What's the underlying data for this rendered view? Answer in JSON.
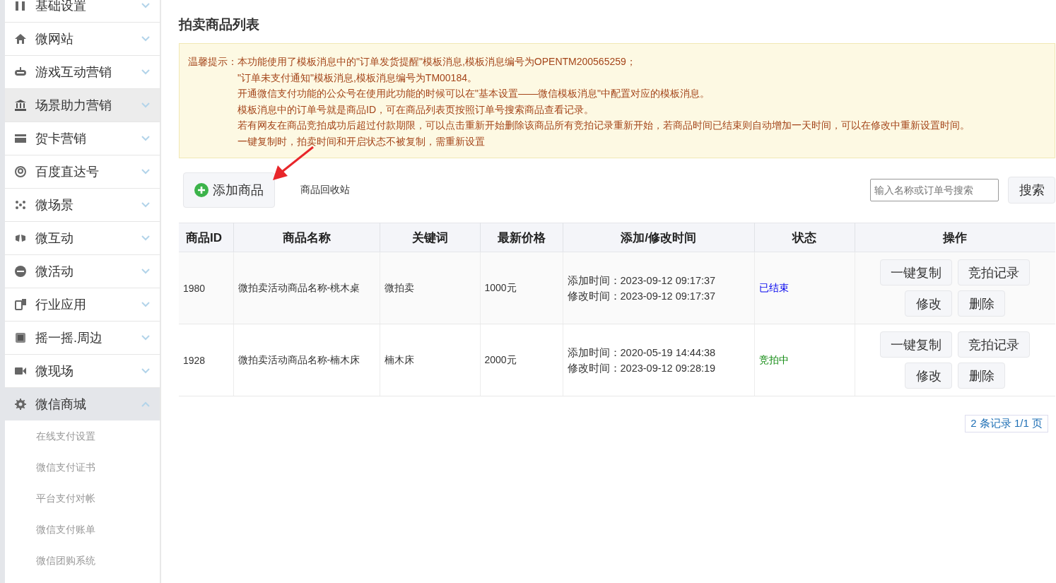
{
  "sidebar": {
    "items": [
      {
        "label": "基础设置",
        "selected": false,
        "expanded": false
      },
      {
        "label": "微网站",
        "selected": false,
        "expanded": false
      },
      {
        "label": "游戏互动营销",
        "selected": false,
        "expanded": false
      },
      {
        "label": "场景助力营销",
        "selected": true,
        "expanded": false
      },
      {
        "label": "贺卡营销",
        "selected": false,
        "expanded": false
      },
      {
        "label": "百度直达号",
        "selected": false,
        "expanded": false
      },
      {
        "label": "微场景",
        "selected": false,
        "expanded": false
      },
      {
        "label": "微互动",
        "selected": false,
        "expanded": false
      },
      {
        "label": "微活动",
        "selected": false,
        "expanded": false
      },
      {
        "label": "行业应用",
        "selected": false,
        "expanded": false
      },
      {
        "label": "摇一摇.周边",
        "selected": false,
        "expanded": false
      },
      {
        "label": "微现场",
        "selected": false,
        "expanded": false
      },
      {
        "label": "微信商城",
        "selected": false,
        "expanded": true,
        "children": [
          {
            "label": "在线支付设置"
          },
          {
            "label": "微信支付证书"
          },
          {
            "label": "平台支付对帐"
          },
          {
            "label": "微信支付账单"
          },
          {
            "label": "微信团购系统"
          }
        ]
      }
    ]
  },
  "page_title": "拍卖商品列表",
  "notice": {
    "label": "温馨提示：",
    "lines": [
      "本功能使用了模板消息中的\"订单发货提醒\"模板消息,模板消息编号为OPENTM200565259；",
      "\"订单未支付通知\"模板消息,模板消息编号为TM00184。",
      "开通微信支付功能的公众号在使用此功能的时候可以在\"基本设置——微信模板消息\"中配置对应的模板消息。",
      "模板消息中的订单号就是商品ID，可在商品列表页按照订单号搜索商品查看记录。",
      "若有网友在商品竞拍成功后超过付款期限，可以点击重新开始删除该商品所有竞拍记录重新开始，若商品时间已结束则自动增加一天时间，可以在修改中重新设置时间。",
      "一键复制时，拍卖时间和开启状态不被复制，需重新设置"
    ]
  },
  "toolbar": {
    "add_button": "添加商品",
    "recycle_link": "商品回收站",
    "search": {
      "placeholder": "输入名称或订单号搜索"
    },
    "search_button": "搜索"
  },
  "table": {
    "columns": [
      "商品ID",
      "商品名称",
      "关键词",
      "最新价格",
      "添加/修改时间",
      "状态",
      "操作"
    ],
    "rows": [
      {
        "id": "1980",
        "name": "微拍卖活动商品名称-桃木桌",
        "keyword": "微拍卖",
        "price": "1000元",
        "added": "添加时间：2023-09-12 09:17:37",
        "modified": "修改时间：2023-09-12 09:17:37",
        "status": {
          "label": "已结束",
          "kind": "ended"
        },
        "actions": [
          "一键复制",
          "竞拍记录",
          "修改",
          "删除"
        ]
      },
      {
        "id": "1928",
        "name": "微拍卖活动商品名称-楠木床",
        "keyword": "楠木床",
        "price": "2000元",
        "added": "添加时间：2020-05-19 14:44:38",
        "modified": "修改时间：2023-09-12 09:28:19",
        "status": {
          "label": "竞拍中",
          "kind": "active"
        },
        "actions": [
          "一键复制",
          "竞拍记录",
          "修改",
          "删除"
        ]
      }
    ]
  },
  "pagination": "2 条记录 1/1 页"
}
